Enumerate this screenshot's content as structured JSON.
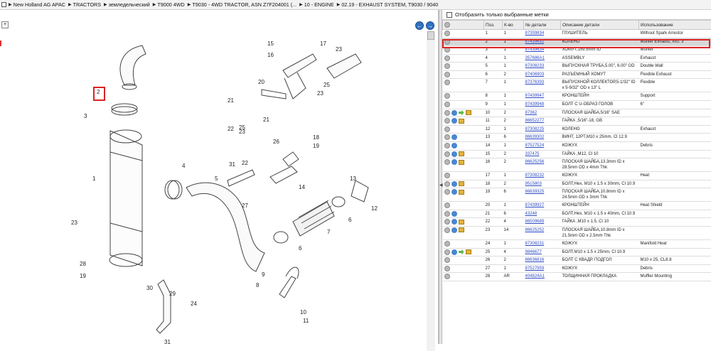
{
  "breadcrumb": [
    "New Holland AG APAC",
    "TRACTORS",
    "земледельческий",
    "T9000 4WD",
    "T9030 - 4WD TRACTOR, ASN Z7F204001 (...",
    "10 - ENGINE",
    "02.19 - EXHAUST SYSTEM, T9030 / 9040"
  ],
  "filter_label": "Отобразить только выбранные метки",
  "columns": [
    "Поз.",
    "К-во",
    "№ детали",
    "Описание детали",
    "Использование"
  ],
  "rows": [
    {
      "pos": "1",
      "qty": "1",
      "part": "87359834",
      "desc": "ГЛУШИТЕЛЬ",
      "use": "Without Spark Arrestor",
      "icons": "c"
    },
    {
      "pos": "2",
      "qty": "1",
      "part": "87439632",
      "desc": "КОЛЕНО",
      "use": "Muffler Exhaust, Incl. 3",
      "icons": "c"
    },
    {
      "pos": "3",
      "qty": "1",
      "part": "87439634",
      "desc": "ХОМУТ,159.5mm ID",
      "use": "Muffler",
      "icons": "c"
    },
    {
      "pos": "4",
      "qty": "1",
      "part": "357686A1",
      "desc": "ASSEMBLY",
      "use": "Exhaust",
      "icons": "c"
    },
    {
      "pos": "5",
      "qty": "1",
      "part": "87308233",
      "desc": "ВЫПУСКНАЯ ТРУБА,5.00\", 6.00\" OD",
      "use": "Double Wall",
      "icons": "c"
    },
    {
      "pos": "6",
      "qty": "2",
      "part": "87406903",
      "desc": "РАЗЪЕМНЫЙ ХОМУТ",
      "use": "Flexible Exhaust",
      "icons": "c"
    },
    {
      "pos": "7",
      "qty": "1",
      "part": "87376393",
      "desc": "ВЫПУСКНОЙ КОЛЛЕКТОР,5-1/32\" ID x 5-9/32\" OD x 13\" L",
      "use": "Flexible",
      "icons": "c"
    },
    {
      "pos": "8",
      "qty": "1",
      "part": "87439947",
      "desc": "КРОНШТЕЙН",
      "use": "Support",
      "icons": "c"
    },
    {
      "pos": "9",
      "qty": "1",
      "part": "87439948",
      "desc": "БОЛТ С U-ОБРАЗ ГОЛОВ",
      "use": "6\"",
      "icons": "c"
    },
    {
      "pos": "10",
      "qty": "2",
      "part": "87362",
      "desc": "ПЛОСКАЯ ШАЙБА,5/16\" SAE",
      "use": "",
      "icons": "cbgy"
    },
    {
      "pos": "11",
      "qty": "2",
      "part": "86652277",
      "desc": "ГАЙКА ,5/16\"-18, GB",
      "use": "",
      "icons": "cby"
    },
    {
      "pos": "12",
      "qty": "1",
      "part": "87308225",
      "desc": "КОЛЕНО",
      "use": "Exhaust",
      "icons": "c"
    },
    {
      "pos": "13",
      "qty": "6",
      "part": "86639302",
      "desc": "ВИНТ, 12PT,M10 x 25mm, Cl 12.9",
      "use": "",
      "icons": "cb"
    },
    {
      "pos": "14",
      "qty": "1",
      "part": "87527524",
      "desc": "КОЖУХ",
      "use": "Debris",
      "icons": "cb"
    },
    {
      "pos": "15",
      "qty": "2",
      "part": "337475",
      "desc": "ГАЙКА ,M12, Cl 10",
      "use": "",
      "icons": "cby"
    },
    {
      "pos": "16",
      "qty": "2",
      "part": "86625256",
      "desc": "ПЛОСКАЯ ШАЙБА,13.3mm ID x 28.5mm OD x 4mm Thk",
      "use": "",
      "icons": "cby"
    },
    {
      "pos": "17",
      "qty": "1",
      "part": "87308232",
      "desc": "КОЖУХ",
      "use": "Heat",
      "icons": "c"
    },
    {
      "pos": "18",
      "qty": "2",
      "part": "9515803",
      "desc": "БОЛТ,Hex, M10 x 1.5 x 30mm, Cl 10.9",
      "use": "",
      "icons": "cby"
    },
    {
      "pos": "19",
      "qty": "6",
      "part": "86639325",
      "desc": "ПЛОСКАЯ ШАЙБА,10.8mm ID x 24.5mm OD x 3mm Thk",
      "use": "",
      "icons": "cby"
    },
    {
      "pos": "20",
      "qty": "1",
      "part": "87439927",
      "desc": "КРОНШТЕЙН",
      "use": "Heat Shield",
      "icons": "c"
    },
    {
      "pos": "21",
      "qty": "6",
      "part": "43248",
      "desc": "БОЛТ,Hex, M10 x 1.5 x 40mm, Cl 10.9",
      "use": "",
      "icons": "cb"
    },
    {
      "pos": "22",
      "qty": "4",
      "part": "86509689",
      "desc": "ГАЙКА ,M10 x 1.5, Cl 10",
      "use": "",
      "icons": "cby"
    },
    {
      "pos": "23",
      "qty": "14",
      "part": "86625252",
      "desc": "ПЛОСКАЯ ШАЙБА,10.8mm ID x 21.5mm OD x 2.5mm Thk",
      "use": "",
      "icons": "cby"
    },
    {
      "pos": "24",
      "qty": "1",
      "part": "87308231",
      "desc": "КОЖУХ",
      "use": "Manifold Heat",
      "icons": "c"
    },
    {
      "pos": "25",
      "qty": "4",
      "part": "9846677",
      "desc": "БОЛТ,M10 x 1.5 x 25mm, Cl 10.9",
      "use": "",
      "icons": "cbgy"
    },
    {
      "pos": "26",
      "qty": "2",
      "part": "86636816",
      "desc": "БОЛТ С КВАДР. ПОДГОЛ",
      "use": "M10 x 25, CL8.8",
      "icons": "c"
    },
    {
      "pos": "27",
      "qty": "1",
      "part": "87527959",
      "desc": "КОЖУХ",
      "use": "Debris",
      "icons": "c"
    },
    {
      "pos": "28",
      "qty": "AR",
      "part": "404824A1",
      "desc": "ТОЛЩИННАЯ ПРОКЛАДКА",
      "use": "Muffler Mounting",
      "icons": "c"
    }
  ],
  "selected_row": 1,
  "callouts": [
    "1",
    "2",
    "3",
    "4",
    "5",
    "6",
    "6",
    "7",
    "8",
    "9",
    "10",
    "11",
    "12",
    "13",
    "14",
    "15",
    "16",
    "17",
    "18",
    "19",
    "20",
    "21",
    "21",
    "22",
    "23",
    "23",
    "23",
    "24",
    "25",
    "25",
    "26",
    "27",
    "28",
    "19",
    "29",
    "30",
    "31",
    "31",
    "22",
    "23"
  ],
  "nav": {
    "back": "←",
    "forward": "→"
  }
}
